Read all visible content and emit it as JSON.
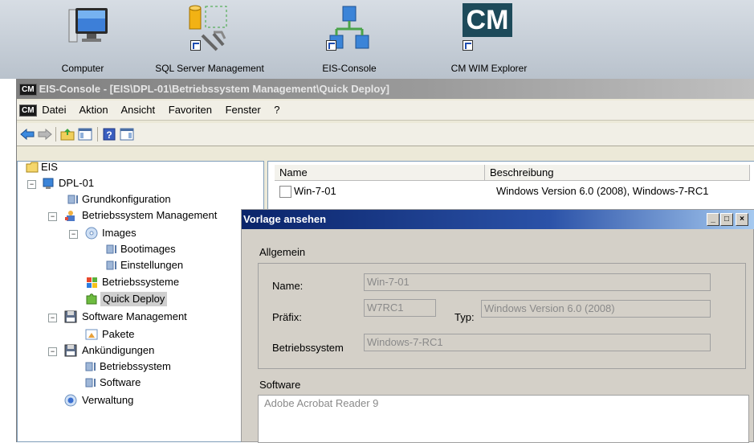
{
  "desktop": {
    "icons": [
      {
        "label": "Computer",
        "icon": "computer-icon"
      },
      {
        "label": "SQL Server Management",
        "icon": "sql-server-icon"
      },
      {
        "label": "EIS-Console",
        "icon": "network-icon"
      },
      {
        "label": "CM WIM Explorer",
        "icon": "cm-icon",
        "badge": "CM"
      }
    ]
  },
  "window": {
    "badge": "CM",
    "title": "EIS-Console - [EIS\\DPL-01\\Betriebssystem Management\\Quick Deploy]"
  },
  "menu": {
    "badge": "CM",
    "items": [
      "Datei",
      "Aktion",
      "Ansicht",
      "Favoriten",
      "Fenster",
      "?"
    ]
  },
  "tree": {
    "root": "EIS",
    "dpl": "DPL-01",
    "grundkonfiguration": "Grundkonfiguration",
    "betriebssystem_management": "Betriebssystem Management",
    "images": "Images",
    "bootimages": "Bootimages",
    "einstellungen": "Einstellungen",
    "betriebssysteme": "Betriebssysteme",
    "quick_deploy": "Quick Deploy",
    "software_management": "Software Management",
    "pakete": "Pakete",
    "ankuendigungen": "Ankündigungen",
    "ank_betriebssystem": "Betriebssystem",
    "ank_software": "Software",
    "verwaltung": "Verwaltung"
  },
  "list": {
    "columns": [
      "Name",
      "Beschreibung"
    ],
    "rows": [
      {
        "name": "Win-7-01",
        "beschreibung": "Windows Version 6.0 (2008), Windows-7-RC1"
      }
    ]
  },
  "dialog": {
    "title": "Vorlage ansehen",
    "group_allgemein": "Allgemein",
    "name_label": "Name:",
    "name_value": "Win-7-01",
    "praefix_label": "Präfix:",
    "praefix_value": "W7RC1",
    "typ_label": "Typ:",
    "typ_value": "Windows Version 6.0 (2008)",
    "bs_label": "Betriebssystem",
    "bs_value": "Windows-7-RC1",
    "software_label": "Software",
    "software_items": [
      "Adobe Acrobat Reader 9"
    ]
  },
  "colors": {
    "dialog_title_start": "#0a246a",
    "dialog_title_end": "#a6caf0",
    "selection": "#cfcfcf"
  }
}
